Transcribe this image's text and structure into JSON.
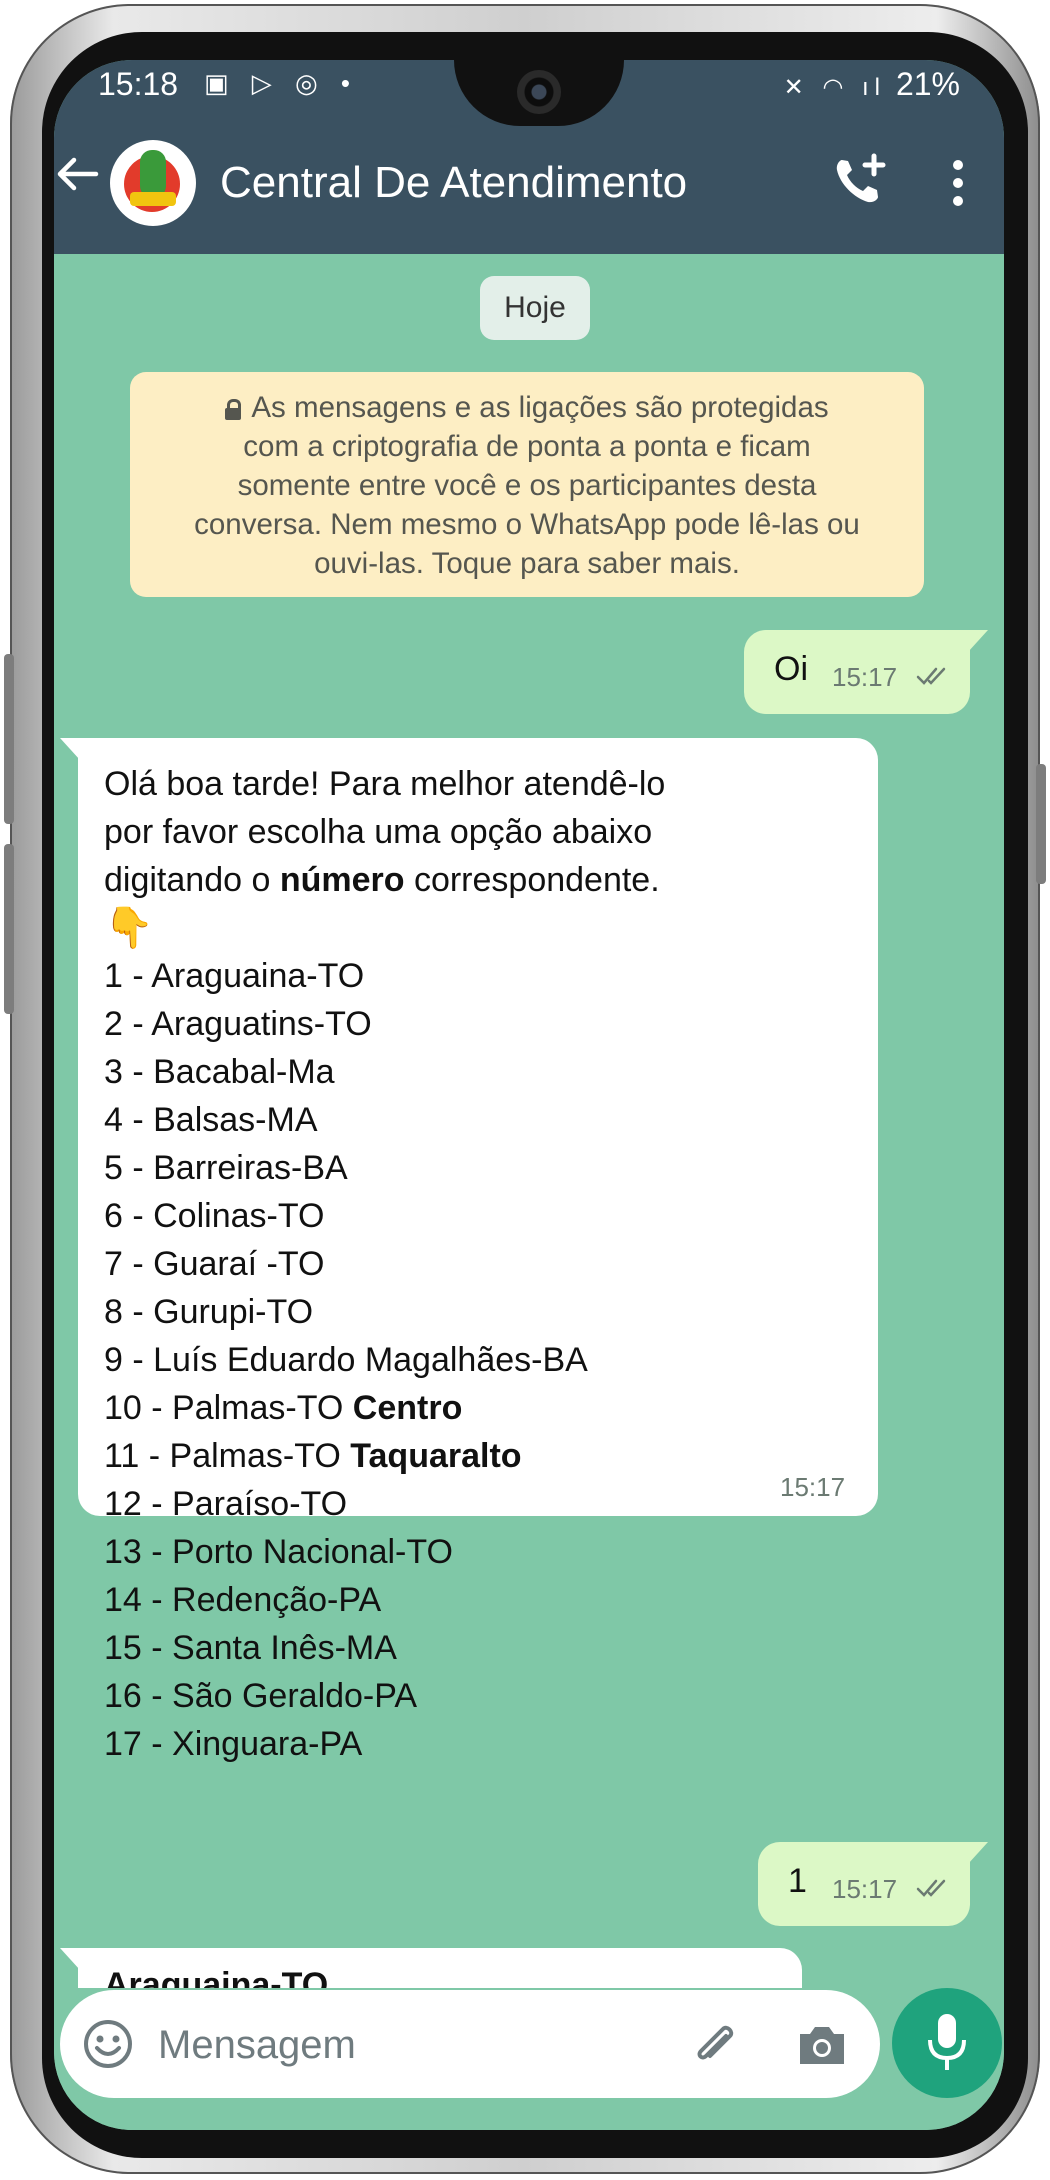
{
  "status_bar": {
    "time": "15:18",
    "left_icons": "▣ ▷ ◎ •",
    "right_icons": "✕ ◠ ıl",
    "battery": "21%"
  },
  "header": {
    "title": "Central De Atendimento",
    "back_icon": "arrow-left-icon",
    "call_icon": "add-call-icon",
    "menu_icon": "more-vertical-icon",
    "bg_color": "#3a5161"
  },
  "chat": {
    "bg_color": "#7fc8a7",
    "date_chip": "Hoje",
    "encryption_notice": [
      "As mensagens e as ligações são protegidas",
      "com a criptografia de ponta a ponta e ficam",
      "somente entre você e os participantes desta",
      "conversa. Nem mesmo o WhatsApp pode lê-las ou",
      "ouvi-las. Toque para saber mais."
    ],
    "messages": [
      {
        "direction": "out",
        "text": "Oi",
        "time": "15:17",
        "status": "read"
      },
      {
        "direction": "in",
        "intro": [
          "Olá boa tarde! Para melhor atendê-lo",
          "por favor escolha uma opção abaixo"
        ],
        "intro3_prefix": "digitando o ",
        "intro3_bold": "número",
        "intro3_suffix": " correspondente.",
        "emoji": "👇",
        "options": [
          "1 - Araguaina-TO",
          "2 - Araguatins-TO",
          "3 - Bacabal-Ma",
          "4 - Balsas-MA",
          "5 - Barreiras-BA",
          "6 - Colinas-TO",
          "7 - Guaraí -TO",
          "8 - Gurupi-TO",
          "9 - Luís Eduardo Magalhães-BA"
        ],
        "option10_prefix": "10 - Palmas-TO ",
        "option10_bold": "Centro",
        "option11_prefix": "11 - Palmas-TO ",
        "option11_bold": "Taquaralto",
        "options_rest": [
          "12 - Paraíso-TO",
          "13 - Porto Nacional-TO",
          "14 - Redenção-PA",
          "15 - Santa Inês-MA",
          "16 - São Geraldo-PA",
          "17 - Xinguara-PA"
        ],
        "time": "15:17"
      },
      {
        "direction": "out",
        "text": "1",
        "time": "15:17",
        "status": "read"
      },
      {
        "direction": "in",
        "partial_bold": "Araguaina-TO"
      }
    ]
  },
  "input_bar": {
    "placeholder": "Mensagem",
    "emoji_icon": "smile-icon",
    "attach_icon": "paperclip-icon",
    "camera_icon": "camera-icon",
    "mic_icon": "microphone-icon",
    "accent_color": "#1fa37d"
  }
}
